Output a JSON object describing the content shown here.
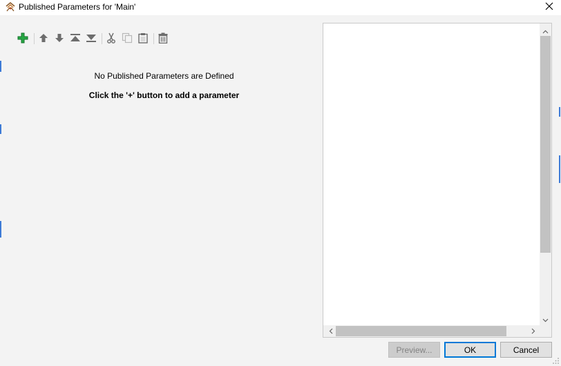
{
  "window": {
    "title": "Published Parameters for 'Main'",
    "app_icon": "fme-workbench-icon",
    "close_icon": "close-icon"
  },
  "toolbar": {
    "buttons": [
      {
        "name": "add-parameter-button",
        "icon": "plus-icon",
        "enabled": true,
        "color": "#1e9b3a"
      },
      {
        "name": "move-up-button",
        "icon": "arrow-up-icon",
        "enabled": true
      },
      {
        "name": "move-down-button",
        "icon": "arrow-down-icon",
        "enabled": true
      },
      {
        "name": "move-to-top-button",
        "icon": "move-to-top-icon",
        "enabled": true
      },
      {
        "name": "move-to-bottom-button",
        "icon": "move-to-bottom-icon",
        "enabled": true
      },
      {
        "name": "cut-button",
        "icon": "scissors-icon",
        "enabled": true
      },
      {
        "name": "copy-button",
        "icon": "copy-icon",
        "enabled": false
      },
      {
        "name": "paste-button",
        "icon": "clipboard-icon",
        "enabled": true
      },
      {
        "name": "delete-button",
        "icon": "trash-icon",
        "enabled": true
      }
    ]
  },
  "parameters_panel": {
    "empty_message": "No Published Parameters are Defined",
    "hint": "Click the '+' button to add a parameter"
  },
  "buttons": {
    "preview": "Preview...",
    "ok": "OK",
    "cancel": "Cancel"
  },
  "colors": {
    "background": "#f3f3f3",
    "accent": "#0078d7",
    "add_icon": "#1e9b3a"
  }
}
